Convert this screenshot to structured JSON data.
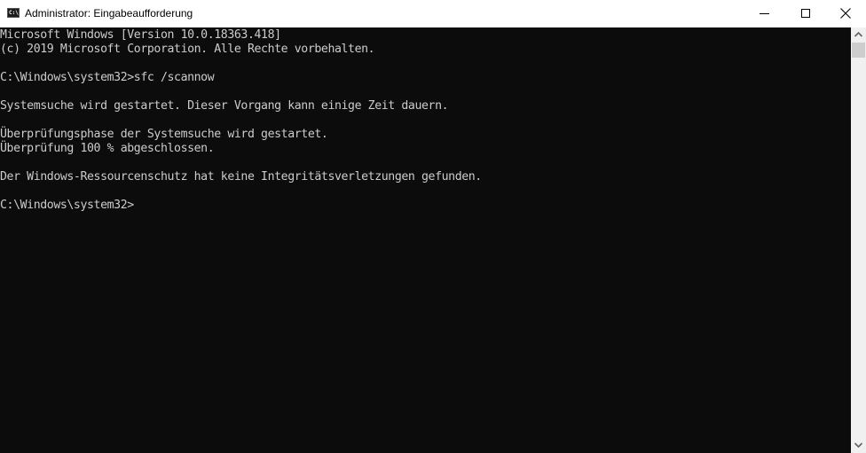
{
  "window": {
    "title": "Administrator: Eingabeaufforderung",
    "icon": "cmd-icon",
    "icon_text": "C:\\",
    "controls": {
      "minimize": "minimize-icon",
      "maximize": "maximize-icon",
      "close": "close-icon"
    }
  },
  "console": {
    "lines": [
      "Microsoft Windows [Version 10.0.18363.418]",
      "(c) 2019 Microsoft Corporation. Alle Rechte vorbehalten.",
      "",
      "C:\\Windows\\system32>sfc /scannow",
      "",
      "Systemsuche wird gestartet. Dieser Vorgang kann einige Zeit dauern.",
      "",
      "Überprüfungsphase der Systemsuche wird gestartet.",
      "Überprüfung 100 % abgeschlossen.",
      "",
      "Der Windows-Ressourcenschutz hat keine Integritätsverletzungen gefunden.",
      "",
      "C:\\Windows\\system32>"
    ]
  },
  "scrollbar": {
    "up": "chevron-up-icon",
    "down": "chevron-down-icon"
  }
}
